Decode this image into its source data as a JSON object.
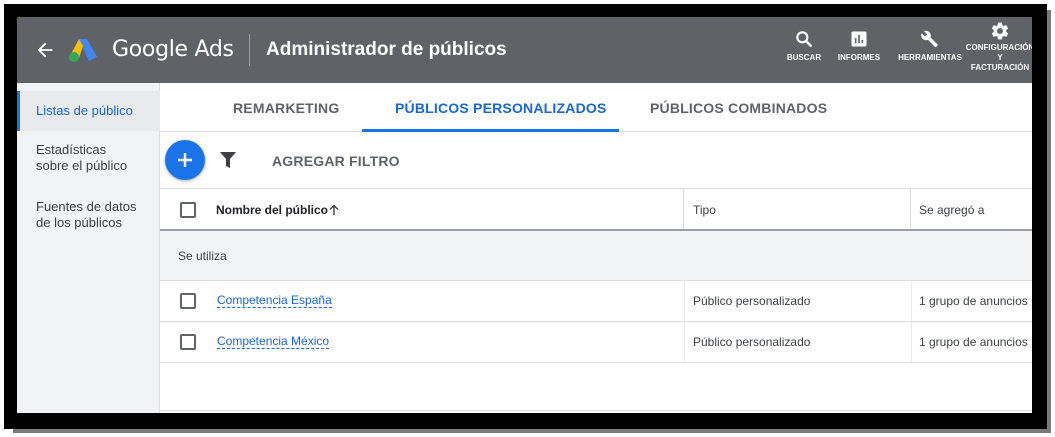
{
  "header": {
    "brand": "Google Ads",
    "title": "Administrador de públicos",
    "tools": [
      {
        "icon": "search-icon",
        "label": "BUSCAR"
      },
      {
        "icon": "bar-chart-icon",
        "label": "INFORMES"
      },
      {
        "icon": "wrench-icon",
        "label": "HERRAMIENTAS"
      },
      {
        "icon": "gear-icon",
        "label_lines": [
          "CONFIGURACIÓN",
          "Y",
          "FACTURACIÓN"
        ]
      }
    ]
  },
  "sidebar": {
    "items": [
      {
        "label": "Listas de público",
        "active": true
      },
      {
        "label_lines": [
          "Estadísticas",
          "sobre el público"
        ]
      },
      {
        "label_lines": [
          "Fuentes de datos",
          "de los públicos"
        ]
      }
    ]
  },
  "tabs": [
    {
      "label": "REMARKETING"
    },
    {
      "label": "PÚBLICOS PERSONALIZADOS",
      "active": true
    },
    {
      "label": "PÚBLICOS COMBINADOS"
    }
  ],
  "toolbar": {
    "add_filter_label": "AGREGAR FILTRO"
  },
  "table": {
    "columns": [
      "Nombre del público",
      "Tipo",
      "Se agregó a"
    ],
    "group_label": "Se utiliza",
    "rows": [
      {
        "name": "Competencia España",
        "type": "Público personalizado",
        "added": "1 grupo de anuncios"
      },
      {
        "name": "Competencia México",
        "type": "Público personalizado",
        "added": "1 grupo de anuncios"
      }
    ]
  },
  "colors": {
    "header_bg": "#5f6368",
    "accent": "#1a73e8",
    "link": "#1967d2"
  }
}
